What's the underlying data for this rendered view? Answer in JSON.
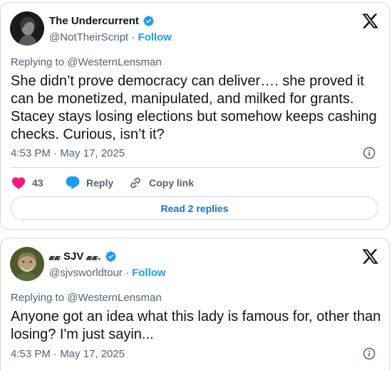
{
  "tweets": [
    {
      "display_name": "The Undercurrent",
      "handle": "@NotTheirScript",
      "separator": "·",
      "follow_label": "Follow",
      "replying_to": "Replying to @WesternLensman",
      "text": "She didn’t prove democracy can deliver…. she proved it can be monetized, manipulated, and milked for grants. Stacey stays losing elections but somehow keeps cashing checks. Curious, isn’t it?",
      "timestamp": "4:53 PM · May 17, 2025",
      "like_count": "43",
      "reply_label": "Reply",
      "copy_link_label": "Copy link",
      "read_replies_label": "Read 2 replies"
    },
    {
      "display_name": "𝔁𝔁 SJV 𝔁𝔁.",
      "handle": "@sjvsworldtour",
      "separator": "·",
      "follow_label": "Follow",
      "replying_to": "Replying to @WesternLensman",
      "text": "Anyone got an idea what this lady is famous for, other than losing? I'm just sayin...",
      "timestamp": "4:53 PM · May 17, 2025"
    }
  ],
  "colors": {
    "accent": "#1d9bf0",
    "like": "#f91880",
    "text_primary": "#0f1419",
    "text_secondary": "#536471",
    "border": "#cfd9de"
  },
  "icons": [
    "verified-badge-icon",
    "x-logo-icon",
    "info-icon",
    "heart-icon",
    "reply-icon",
    "link-icon"
  ]
}
